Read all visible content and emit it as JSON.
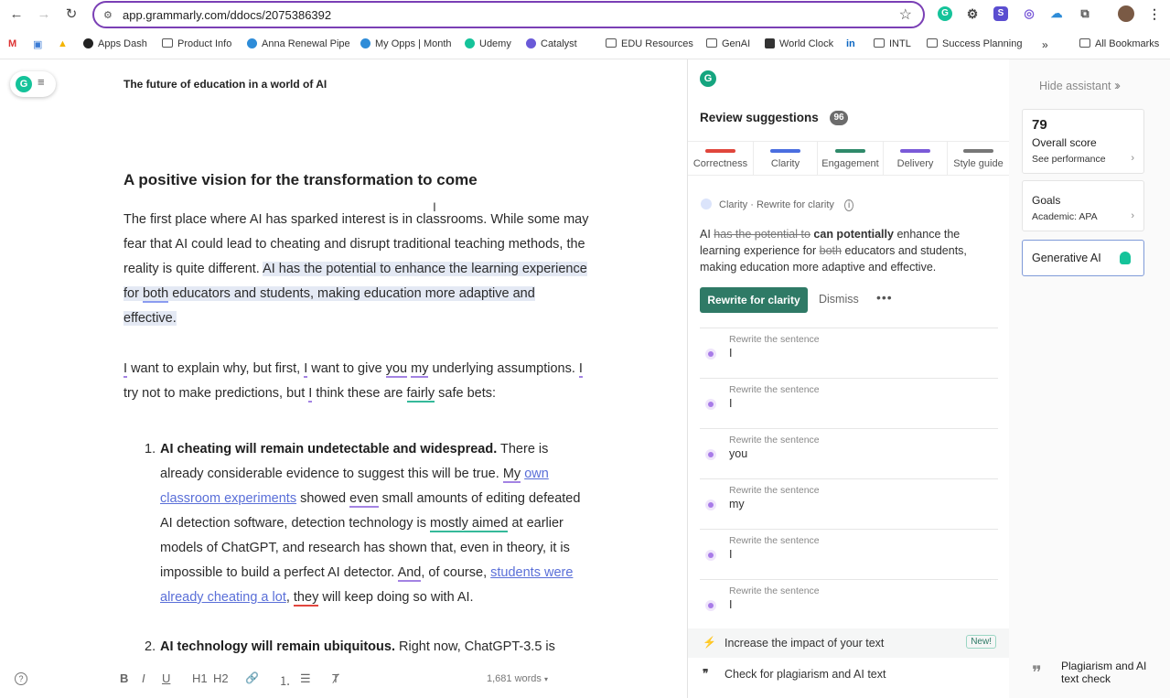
{
  "browser": {
    "url": "app.grammarly.com/ddocs/2075386392",
    "bookmarks": [
      "Apps Dash",
      "Product Info",
      "Anna Renewal Pipe",
      "My Opps | Month",
      "Udemy",
      "Catalyst",
      "EDU Resources",
      "GenAI",
      "World Clock",
      "INTL",
      "Success Planning",
      "All Bookmarks"
    ],
    "more_bookmarks": "»"
  },
  "editor": {
    "doc_title": "The future of education in a world of AI",
    "heading": "A positive vision for the transformation to come",
    "p1": {
      "plain": "The first place where AI has sparked interest is in classrooms. While some may fear that AI could lead to cheating and disrupt traditional teaching methods, the reality is quite different.",
      "hl_a": "AI has the potential to enhance the learning experience for",
      "hl_both": "both",
      "hl_b": "educators and students, making education more adaptive and effective."
    },
    "p2": {
      "w_i1": "I",
      "t1": "want to explain why, but first,",
      "w_i2": "I",
      "t2": "want to give",
      "w_you": "you",
      "w_my": "my",
      "t3": "underlying assumptions.",
      "w_i3": "I",
      "t4": "try not to make predictions, but",
      "w_i4": "I",
      "t5": "think these are",
      "w_fairly": "fairly",
      "t6": "safe bets:"
    },
    "li1": {
      "num": "1.",
      "bold": "AI cheating will remain undetectable and widespread.",
      "t1": "There is already considerable evidence to suggest this will be true.",
      "w_my": "My",
      "link1": "own classroom experiments",
      "t2": "showed",
      "w_even": "even",
      "t3": "small amounts of editing defeated AI detection software, detection technology is",
      "w_mostly": "mostly aimed",
      "t4": "at earlier models of ChatGPT, and research has shown that, even in theory, it is impossible to build a perfect AI detector.",
      "w_and": "And",
      "t5": ", of course,",
      "link2": "students were already cheating a lot",
      "t6": ",",
      "w_they": "they",
      "t7": "will keep doing so with AI."
    },
    "li2": {
      "num": "2.",
      "bold": "AI technology will remain ubiquitous.",
      "t1": "Right now, ChatGPT-3.5 is"
    },
    "toolbar": {
      "help": "?",
      "bold": "B",
      "italic": "I",
      "underline": "U",
      "h1": "H1",
      "h2": "H2",
      "link": "🔗",
      "ol": "⒈",
      "ul": "☰",
      "clear": "Ⱦ",
      "words": "1,681 words"
    }
  },
  "assistant": {
    "title": "Review suggestions",
    "count": "96",
    "categories": [
      {
        "label": "Correctness",
        "color": "#e0463c"
      },
      {
        "label": "Clarity",
        "color": "#4a6ee0"
      },
      {
        "label": "Engagement",
        "color": "#2f8a6a"
      },
      {
        "label": "Delivery",
        "color": "#7a5ad8"
      },
      {
        "label": "Style guide",
        "color": "#777777"
      }
    ],
    "card": {
      "tag": "Clarity · Rewrite for clarity",
      "t_ai": "AI",
      "t_strike1": "has the potential to",
      "t_bold": "can potentially",
      "t_mid": "enhance the learning experience for",
      "t_strike2": "both",
      "t_end": "educators and students, making education more adaptive and effective.",
      "rewrite_btn": "Rewrite for clarity",
      "dismiss_btn": "Dismiss",
      "more_btn": "•••"
    },
    "rewrites": [
      {
        "header": "Rewrite the sentence",
        "word": "I"
      },
      {
        "header": "Rewrite the sentence",
        "word": "I"
      },
      {
        "header": "Rewrite the sentence",
        "word": "you"
      },
      {
        "header": "Rewrite the sentence",
        "word": "my"
      },
      {
        "header": "Rewrite the sentence",
        "word": "I"
      },
      {
        "header": "Rewrite the sentence",
        "word": "I"
      }
    ],
    "impact": {
      "label": "Increase the impact of your text",
      "badge": "New!"
    },
    "plagiarism_check": "Check for plagiarism and AI text"
  },
  "sidebar": {
    "hide_label": "Hide assistant",
    "score": "79",
    "score_label": "Overall score",
    "score_link": "See performance",
    "goals_title": "Goals",
    "goals_value": "Academic: APA",
    "genai": "Generative AI",
    "plagiarism": "Plagiarism and AI text check"
  }
}
